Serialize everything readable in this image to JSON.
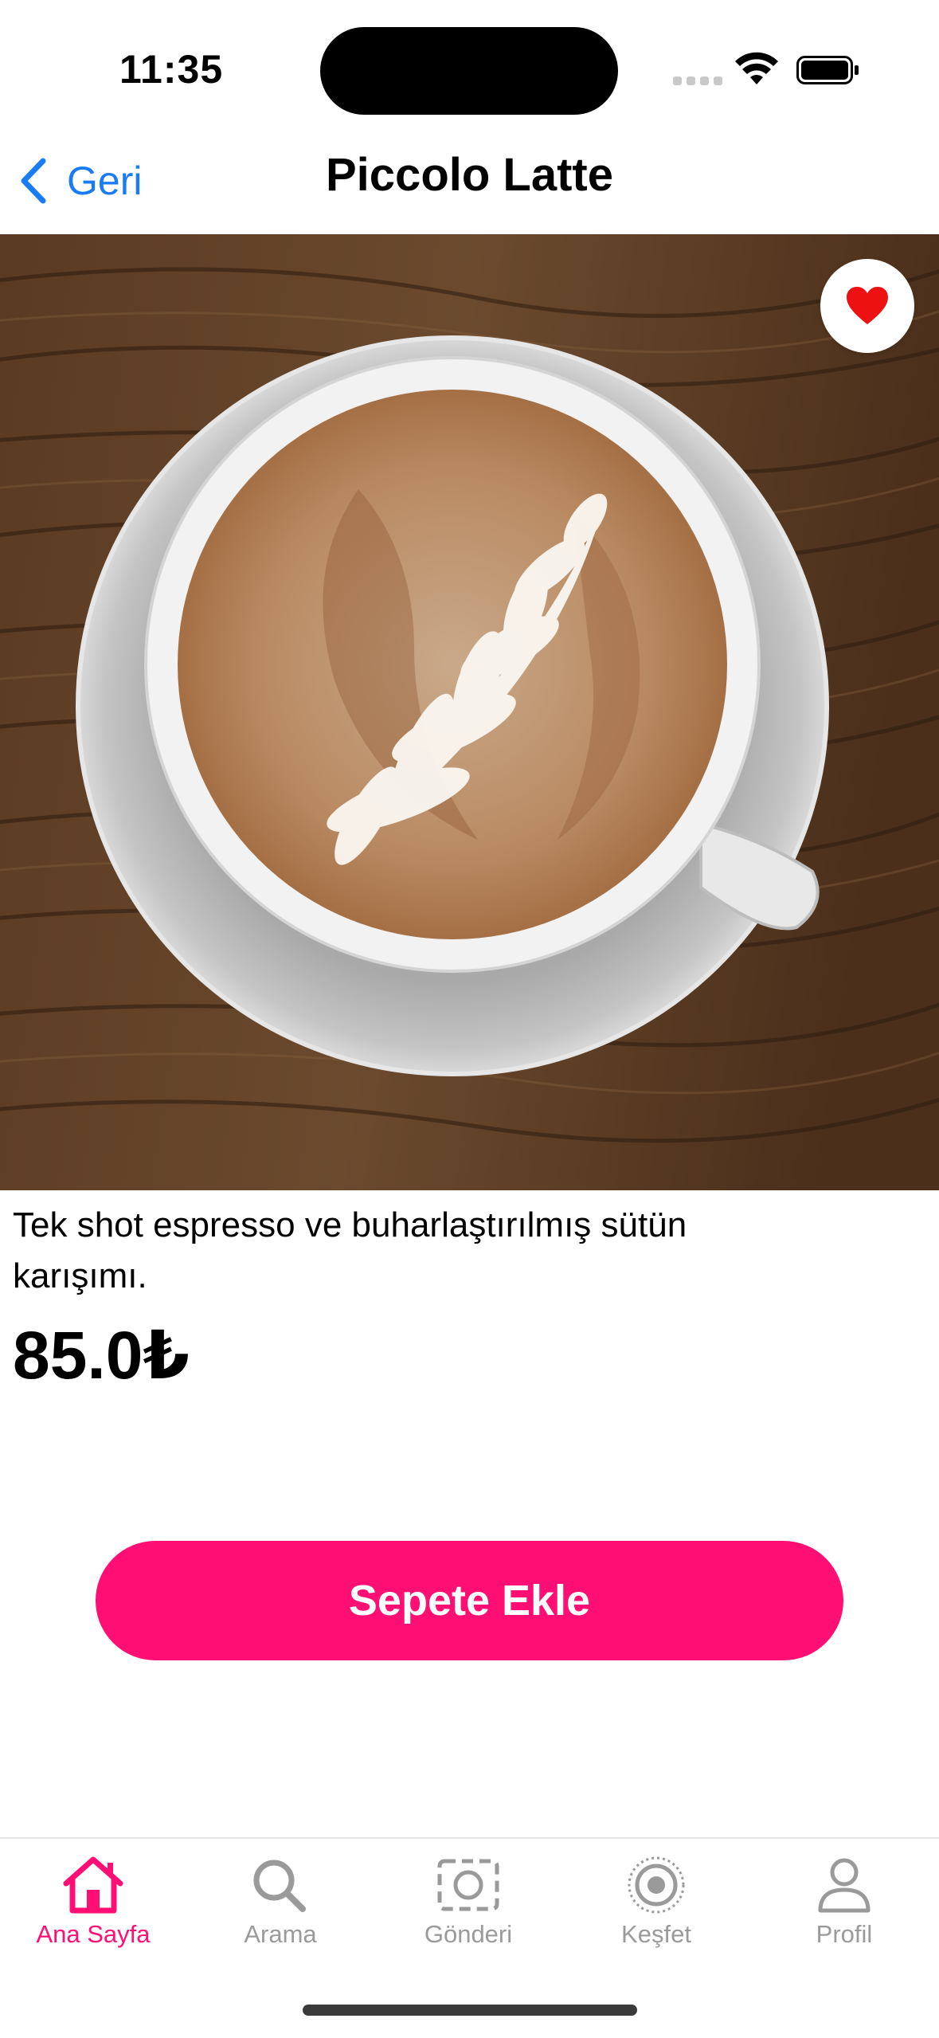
{
  "status_bar": {
    "time": "11:35"
  },
  "nav": {
    "back_label": "Geri",
    "title": "Piccolo Latte"
  },
  "product": {
    "image_alt": "Latte art coffee on wooden table",
    "description": "Tek shot espresso ve buharlaştırılmış sütün karışımı.",
    "price": "85.0₺",
    "favorite": true
  },
  "actions": {
    "add_to_cart": "Sepete Ekle"
  },
  "tabs": [
    {
      "label": "Ana Sayfa",
      "icon": "home-icon",
      "active": true
    },
    {
      "label": "Arama",
      "icon": "search-icon",
      "active": false
    },
    {
      "label": "Gönderi",
      "icon": "camera-frame-icon",
      "active": false
    },
    {
      "label": "Keşfet",
      "icon": "explore-icon",
      "active": false
    },
    {
      "label": "Profil",
      "icon": "person-icon",
      "active": false
    }
  ],
  "colors": {
    "accent": "#ff0f74",
    "link": "#1a7cf5",
    "heart": "#ee1111",
    "inactive": "#9a9a9a"
  }
}
